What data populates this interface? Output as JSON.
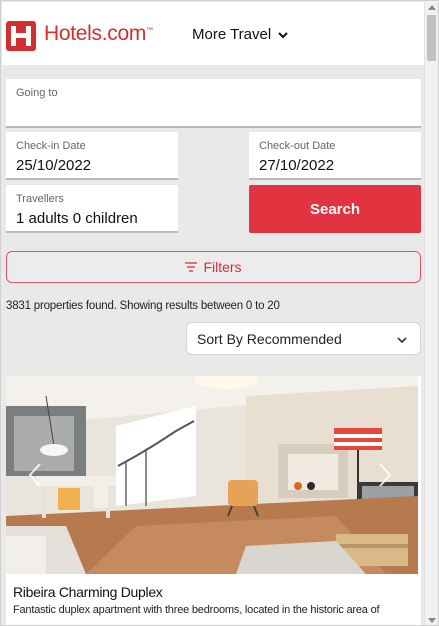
{
  "header": {
    "logo_text": "Hotels.com",
    "logo_tm": "™",
    "more_travel": "More Travel",
    "brand_color": "#d32f2f"
  },
  "search": {
    "going_to_label": "Going to",
    "going_to_value": "",
    "checkin_label": "Check-in Date",
    "checkin_value": "25/10/2022",
    "checkout_label": "Check-out Date",
    "checkout_value": "27/10/2022",
    "travellers_label": "Travellers",
    "travellers_value": "1 adults 0 children",
    "search_button": "Search",
    "search_button_color": "#e13340"
  },
  "filters": {
    "label": "Filters",
    "icon": "filter-lines-icon"
  },
  "results": {
    "count_text": "3831 properties found. Showing results between 0 to 20"
  },
  "sort": {
    "selected": "Sort By Recommended"
  },
  "properties": [
    {
      "title": "Ribeira Charming Duplex",
      "description": "Fantastic duplex apartment with three bedrooms, located in the historic area of",
      "image": "living-room-photo"
    }
  ]
}
